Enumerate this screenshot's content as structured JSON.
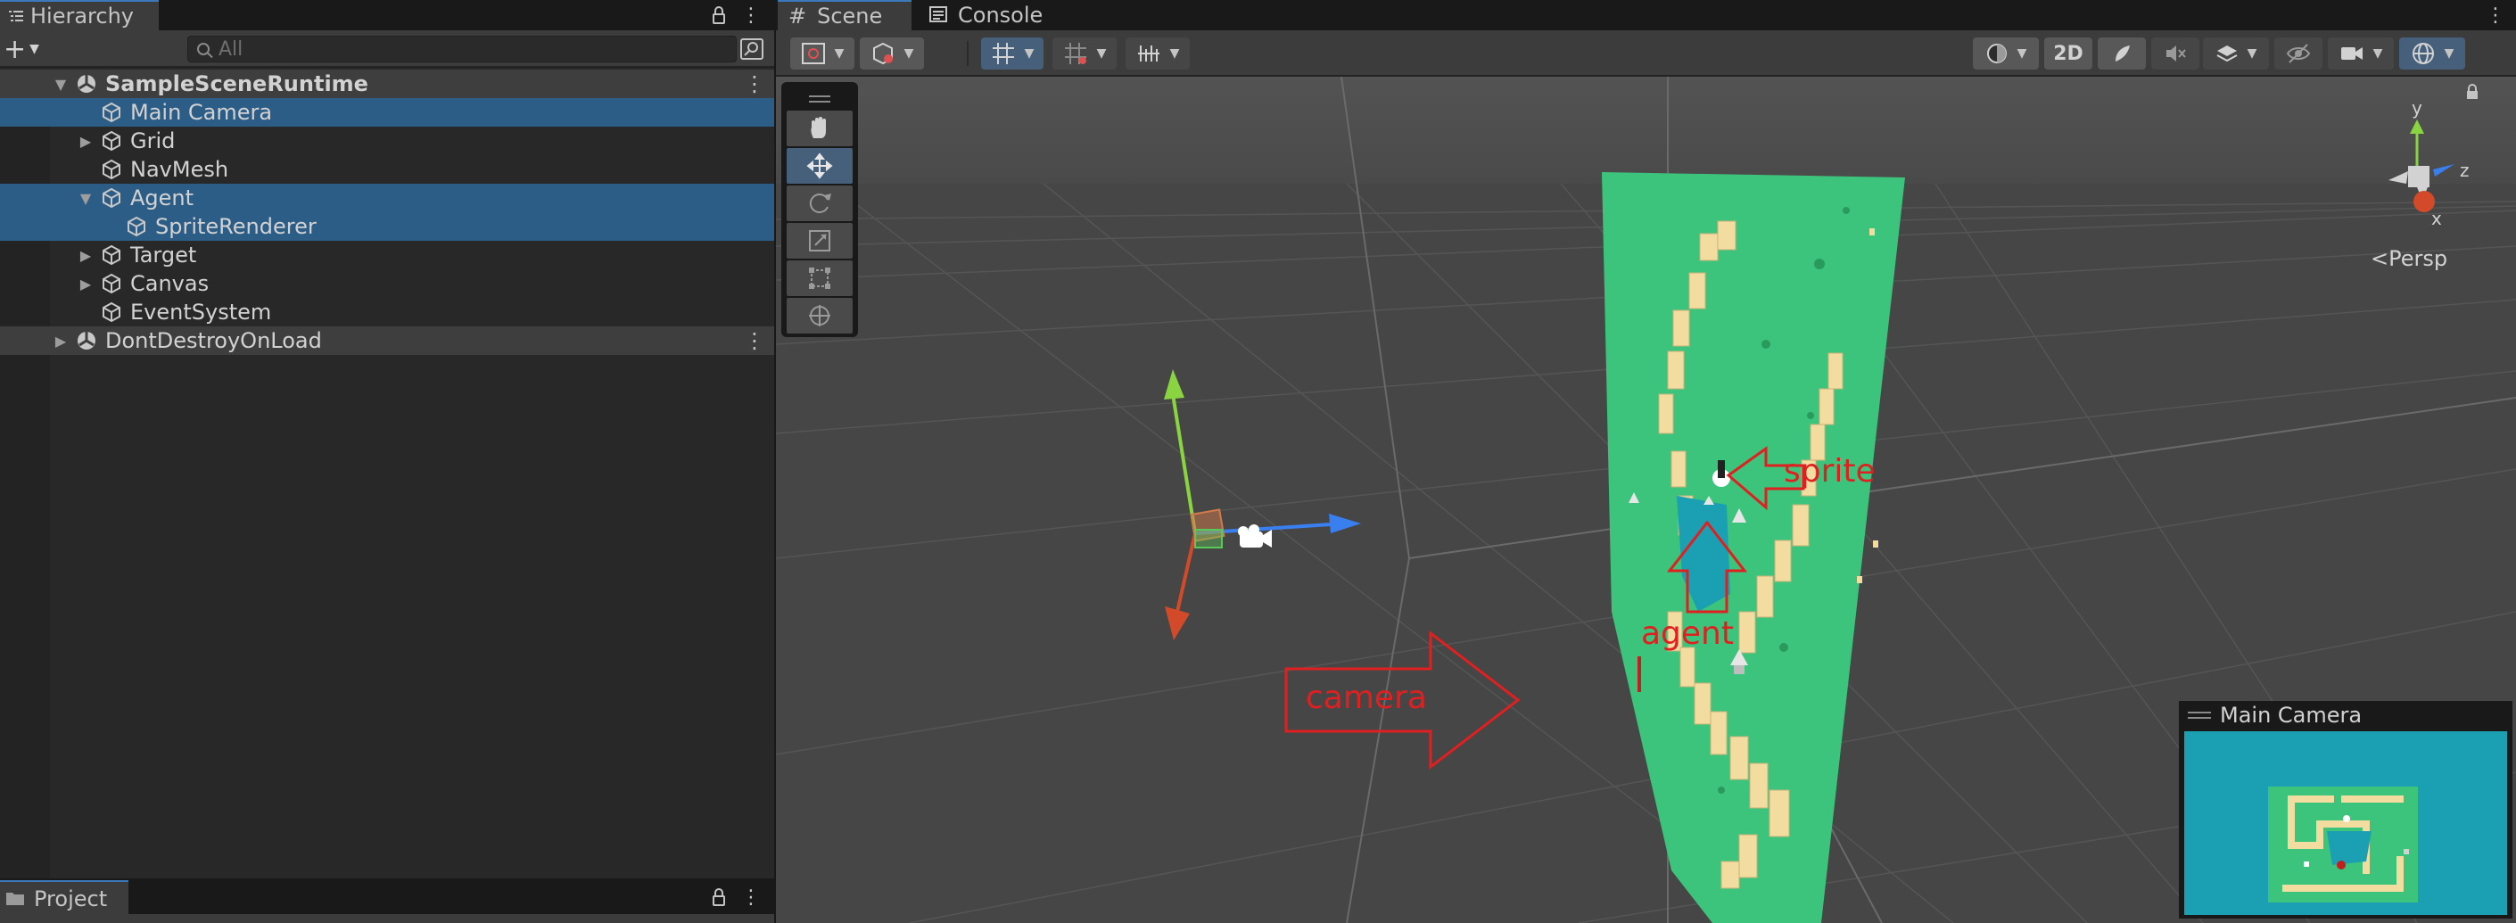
{
  "hierarchy": {
    "tab_title": "Hierarchy",
    "search_placeholder": "All",
    "add_label": "+",
    "items": [
      {
        "label": "SampleSceneRuntime"
      },
      {
        "label": "Main Camera"
      },
      {
        "label": "Grid"
      },
      {
        "label": "NavMesh"
      },
      {
        "label": "Agent"
      },
      {
        "label": "SpriteRenderer"
      },
      {
        "label": "Target"
      },
      {
        "label": "Canvas"
      },
      {
        "label": "EventSystem"
      },
      {
        "label": "DontDestroyOnLoad"
      }
    ]
  },
  "project": {
    "tab_title": "Project"
  },
  "scene_view": {
    "tabs": [
      {
        "label": "Scene"
      },
      {
        "label": "Console"
      }
    ],
    "toolbar": {
      "mode_2d_label": "2D"
    },
    "projection_label": "Persp",
    "gizmo_axes": {
      "y": "y",
      "z": "z",
      "x": "x"
    },
    "camera_preview_title": "Main Camera",
    "annotations": {
      "sprite": "sprite",
      "agent": "agent",
      "camera": "camera"
    }
  },
  "colors": {
    "selection": "#2c5d87",
    "accent": "#3a79bb",
    "plane_green": "#3cc47c",
    "path_tiles": "#f2dca0",
    "water": "#1a9fb3",
    "annotation_red": "#e02020"
  },
  "icons": [
    "hierarchy-list-icon",
    "lock-icon",
    "kebab-menu-icon",
    "search-icon",
    "unity-scene-icon",
    "gameobject-cube-icon",
    "hand-tool-icon",
    "move-tool-icon",
    "rotate-tool-icon",
    "scale-tool-icon",
    "rect-tool-icon",
    "transform-tool-icon",
    "camera-gizmo-icon",
    "folder-icon"
  ]
}
